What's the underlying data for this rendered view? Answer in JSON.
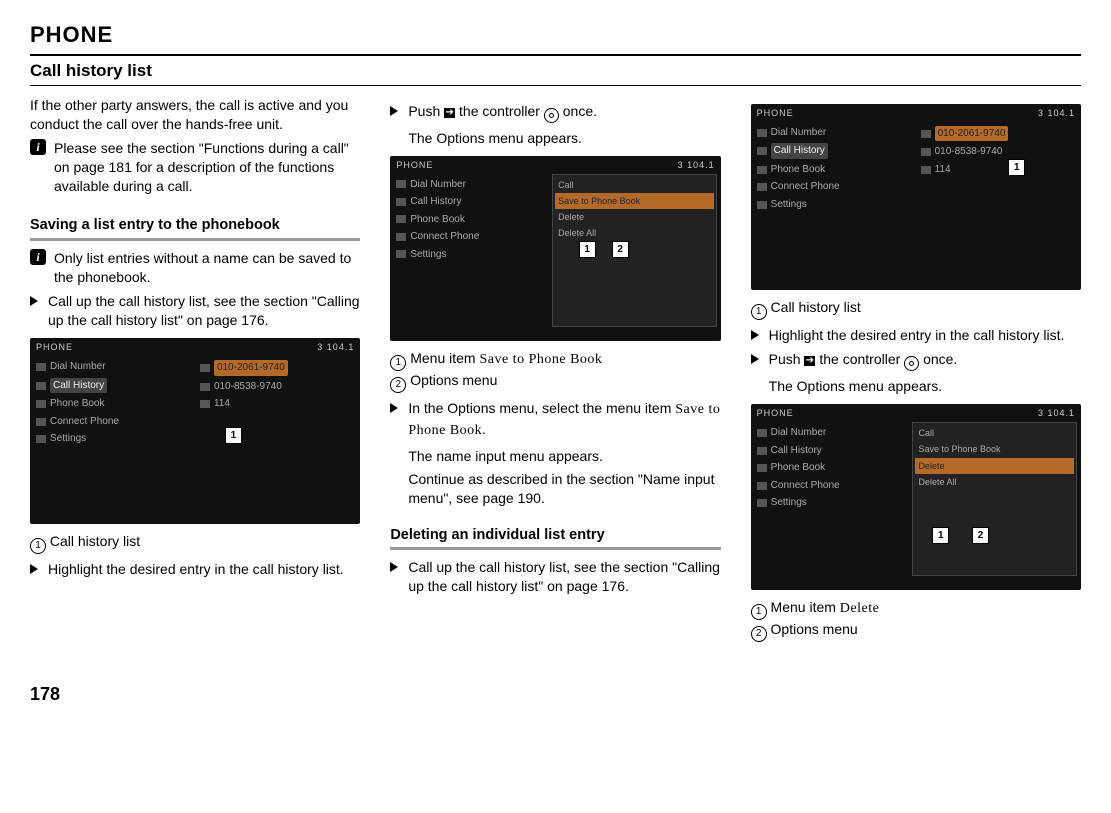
{
  "header": {
    "title": "PHONE",
    "section": "Call history list",
    "page_number": "178"
  },
  "col1": {
    "intro": "If the other party answers, the call is active and you conduct the call over the hands-free unit.",
    "info1": "Please see the section \"Functions during a call\" on page 181 for a description of the functions available during a call.",
    "subhead": "Saving a list entry to the phonebook",
    "info2": "Only list entries without a name can be saved to the phonebook.",
    "step1": "Call up the call history list, see the section \"Calling up the call history list\" on page 176.",
    "caption_num": "1",
    "caption_text": "Call history list",
    "step2": "Highlight the desired entry in the call history list."
  },
  "col2": {
    "step1a": "Push ",
    "step1b": " the controller ",
    "step1c": " once.",
    "step1_sub": "The Options menu appears.",
    "caption1_num": "1",
    "caption1_text": "Menu item ",
    "caption1_item": "Save to Phone Book",
    "caption2_num": "2",
    "caption2_text": "Options menu",
    "step2a": "In the Options menu, select the menu item ",
    "step2b": "Save to Phone Book.",
    "step2_sub1": "The name input menu appears.",
    "step2_sub2": "Continue as described in the section \"Name input menu\", see page 190.",
    "subhead": "Deleting an individual list entry",
    "step3": "Call up the call history list, see the section \"Calling up the call history list\" on page 176."
  },
  "col3": {
    "captionA_num": "1",
    "captionA_text": "Call history list",
    "step1": "Highlight the desired entry in the call history list.",
    "step2a": "Push ",
    "step2b": " the controller ",
    "step2c": " once.",
    "step2_sub": "The Options menu appears.",
    "captionB1_num": "1",
    "captionB1_text": "Menu item ",
    "captionB1_item": "Delete",
    "captionB2_num": "2",
    "captionB2_text": "Options menu"
  },
  "ss": {
    "title": "PHONE",
    "freq": "3   104.1",
    "left": [
      "Dial Number",
      "Call History",
      "Phone Book",
      "Connect Phone",
      "Settings"
    ],
    "numbers": [
      "010-2061-9740",
      "010-8538-9740",
      "114"
    ],
    "pop": [
      "Call",
      "Save to Phone Book",
      "Delete",
      "Delete All"
    ]
  }
}
